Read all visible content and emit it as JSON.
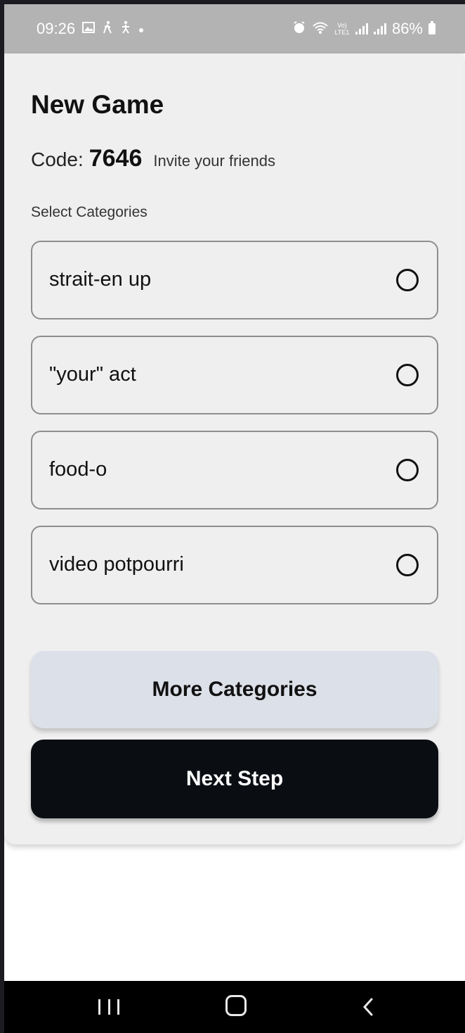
{
  "status_bar": {
    "time": "09:26",
    "left_icons": [
      "gallery-icon",
      "walking-icon",
      "fitness-icon",
      "dot-icon"
    ],
    "right_icons": [
      "alarm-icon",
      "wifi-icon",
      "volte-icon",
      "signal-icon",
      "signal-icon"
    ],
    "volte_text": "Vo) LTE1",
    "battery_text": "86%"
  },
  "header": {
    "title": "New Game"
  },
  "code": {
    "label": "Code:",
    "value": "7646",
    "invite": "Invite your friends"
  },
  "categories": {
    "label": "Select Categories",
    "items": [
      {
        "label": "strait-en up",
        "selected": false
      },
      {
        "label": "\"your\" act",
        "selected": false
      },
      {
        "label": "food-o",
        "selected": false
      },
      {
        "label": "video potpourri",
        "selected": false
      }
    ]
  },
  "buttons": {
    "more_label": "More Categories",
    "next_label": "Next Step"
  },
  "nav_bar": {
    "icons": [
      "recents-icon",
      "home-icon",
      "back-icon"
    ]
  },
  "colors": {
    "status_bar_bg": "#b3b3b3",
    "card_bg": "#efefef",
    "more_button_bg": "#dce0e8",
    "next_button_bg": "#0a0e12",
    "nav_bar_bg": "#000000"
  }
}
